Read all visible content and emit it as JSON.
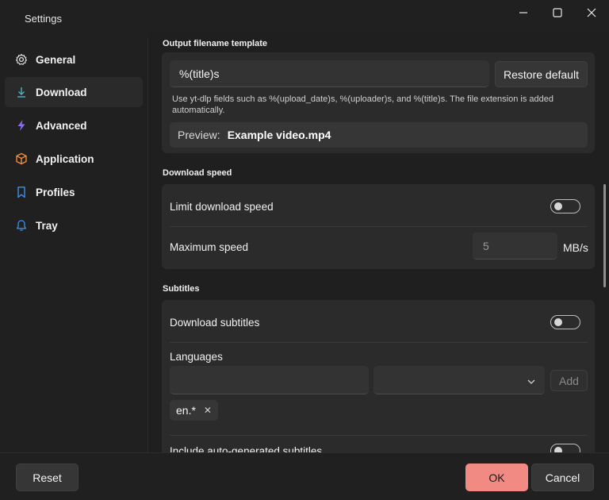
{
  "window": {
    "title": "Settings",
    "controls": {
      "minimize": "minimize-icon",
      "maximize": "maximize-icon",
      "close": "close-icon"
    }
  },
  "sidebar": {
    "items": [
      {
        "label": "General",
        "icon": "gear-icon",
        "active": false
      },
      {
        "label": "Download",
        "icon": "download-icon",
        "active": true
      },
      {
        "label": "Advanced",
        "icon": "lightning-icon",
        "active": false
      },
      {
        "label": "Application",
        "icon": "box-icon",
        "active": false
      },
      {
        "label": "Profiles",
        "icon": "bookmark-icon",
        "active": false
      },
      {
        "label": "Tray",
        "icon": "bell-icon",
        "active": false
      }
    ]
  },
  "output_template": {
    "section_title": "Output filename template",
    "value": "%(title)s",
    "restore_button": "Restore default",
    "hint": "Use yt-dlp fields such as %(upload_date)s, %(uploader)s, and %(title)s. The file extension is added automatically.",
    "preview_label": "Preview:",
    "preview_value": "Example video.mp4"
  },
  "download_speed": {
    "section_title": "Download speed",
    "limit_label": "Limit download speed",
    "limit_enabled": false,
    "max_label": "Maximum speed",
    "max_value": "5",
    "unit": "MB/s"
  },
  "subtitles": {
    "section_title": "Subtitles",
    "download_label": "Download subtitles",
    "download_enabled": false,
    "languages_label": "Languages",
    "language_input_value": "",
    "language_select_value": "",
    "add_button": "Add",
    "chips": [
      {
        "label": "en.*"
      }
    ],
    "auto_generated_label": "Include auto-generated subtitles",
    "auto_generated_enabled": false
  },
  "footer": {
    "reset_button": "Reset",
    "ok_button": "OK",
    "cancel_button": "Cancel"
  },
  "colors": {
    "accent": "#f28a84",
    "accent_icon_download": "#4fb3bf",
    "accent_icon_advanced": "#8a6cf0",
    "accent_icon_application": "#f08c3c",
    "accent_icon_profiles": "#3d8ff0",
    "accent_icon_tray": "#3d8ff0"
  }
}
